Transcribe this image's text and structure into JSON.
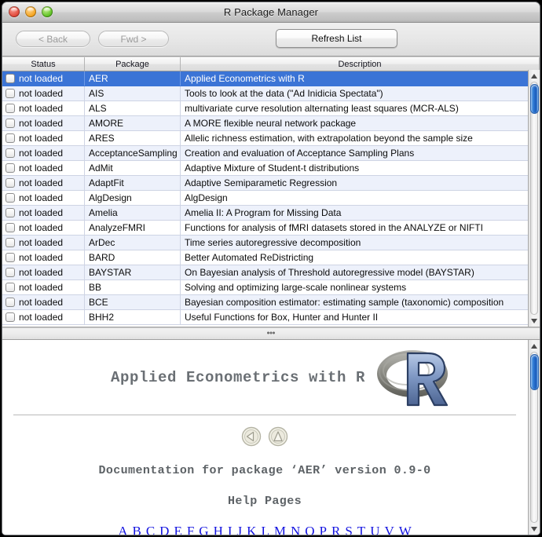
{
  "window": {
    "title": "R Package Manager",
    "controls": [
      {
        "name": "close",
        "color": "#e24b3c"
      },
      {
        "name": "minimize",
        "color": "#f5a623"
      },
      {
        "name": "zoom",
        "color": "#62c327"
      }
    ]
  },
  "toolbar": {
    "back_label": "< Back",
    "forward_label": "Fwd >",
    "refresh_label": "Refresh List"
  },
  "table": {
    "columns": [
      "Status",
      "Package",
      "Description"
    ],
    "rows": [
      {
        "status": "not loaded",
        "package": "AER",
        "description": "Applied Econometrics with R",
        "selected": true
      },
      {
        "status": "not loaded",
        "package": "AIS",
        "description": "Tools to look at the data (\"Ad Inidicia Spectata\")",
        "selected": false
      },
      {
        "status": "not loaded",
        "package": "ALS",
        "description": "multivariate curve resolution alternating least squares (MCR-ALS)",
        "selected": false
      },
      {
        "status": "not loaded",
        "package": "AMORE",
        "description": "A MORE flexible neural network package",
        "selected": false
      },
      {
        "status": "not loaded",
        "package": "ARES",
        "description": "Allelic richness estimation, with extrapolation beyond the sample size",
        "selected": false
      },
      {
        "status": "not loaded",
        "package": "AcceptanceSampling",
        "description": "Creation and evaluation of Acceptance Sampling Plans",
        "selected": false
      },
      {
        "status": "not loaded",
        "package": "AdMit",
        "description": "Adaptive Mixture of Student-t distributions",
        "selected": false
      },
      {
        "status": "not loaded",
        "package": "AdaptFit",
        "description": "Adaptive Semiparametic Regression",
        "selected": false
      },
      {
        "status": "not loaded",
        "package": "AlgDesign",
        "description": "AlgDesign",
        "selected": false
      },
      {
        "status": "not loaded",
        "package": "Amelia",
        "description": "Amelia II: A Program for Missing Data",
        "selected": false
      },
      {
        "status": "not loaded",
        "package": "AnalyzeFMRI",
        "description": "Functions for analysis of fMRI datasets stored in the ANALYZE or NIFTI",
        "selected": false
      },
      {
        "status": "not loaded",
        "package": "ArDec",
        "description": "Time series autoregressive decomposition",
        "selected": false
      },
      {
        "status": "not loaded",
        "package": "BARD",
        "description": "Better Automated ReDistricting",
        "selected": false
      },
      {
        "status": "not loaded",
        "package": "BAYSTAR",
        "description": "On Bayesian analysis of Threshold autoregressive model (BAYSTAR)",
        "selected": false
      },
      {
        "status": "not loaded",
        "package": "BB",
        "description": "Solving and optimizing large-scale nonlinear systems",
        "selected": false
      },
      {
        "status": "not loaded",
        "package": "BCE",
        "description": "Bayesian composition estimator: estimating sample (taxonomic) composition",
        "selected": false
      },
      {
        "status": "not loaded",
        "package": "BHH2",
        "description": "Useful Functions for Box, Hunter and Hunter II",
        "selected": false
      }
    ]
  },
  "doc": {
    "title": "Applied Econometrics with R",
    "logo_name": "r-project-logo",
    "nav": [
      {
        "name": "back-arrow-icon",
        "glyph": "left"
      },
      {
        "name": "up-arrow-icon",
        "glyph": "up"
      }
    ],
    "version_line": "Documentation for package ‘AER’ version 0.9-0",
    "help_pages_heading": "Help Pages",
    "alphabet": [
      "A",
      "B",
      "C",
      "D",
      "E",
      "F",
      "G",
      "H",
      "I",
      "J",
      "K",
      "L",
      "M",
      "N",
      "O",
      "P",
      "R",
      "S",
      "T",
      "U",
      "V",
      "W"
    ]
  },
  "colors": {
    "selection": "#3b74d6",
    "row_alt": "#edf1fb",
    "link": "#1414e0",
    "scrollbar_thumb": "#2f79d4"
  }
}
